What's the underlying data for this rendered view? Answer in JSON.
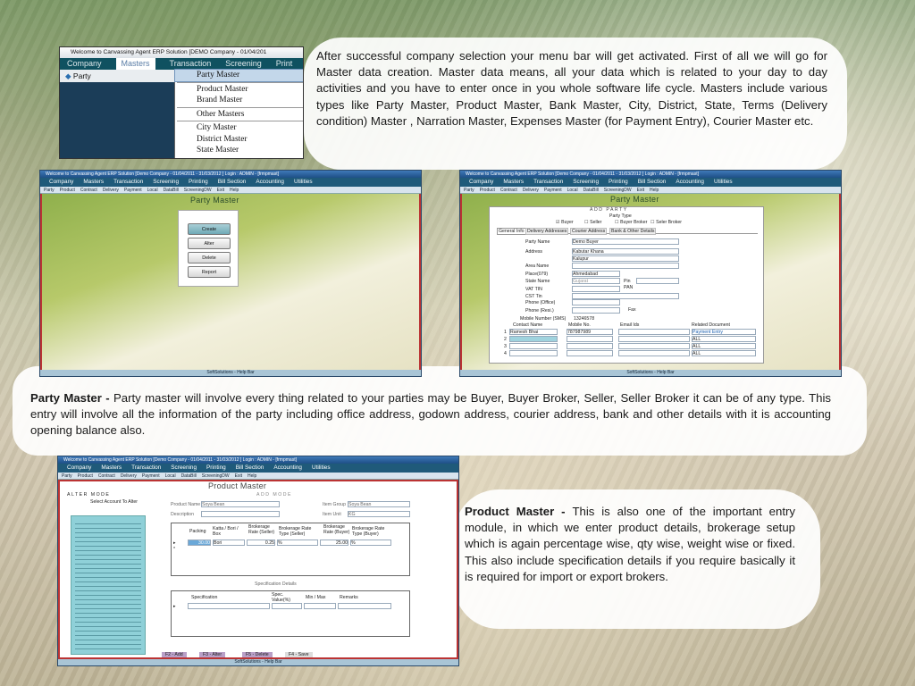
{
  "intro_text": "After successful company selection your menu bar will get activated. First of all we will go for Master data creation. Master data means, all your data which is related to your day to day activities and you have to enter once in you whole software life cycle. Masters include various types like Party Master, Product Master, Bank Master, City, District, State, Terms (Delivery condition)  Master , Narration Master, Expenses Master (for Payment Entry), Courier Master etc.",
  "party_master": {
    "heading": "Party Master",
    "dash": " - ",
    "text": "Party master will involve every thing related to your parties may be Buyer, Buyer Broker, Seller, Seller Broker it can be of any type. This entry will involve all the information of the party including office address, godown address, courier address, bank and other details with it is accounting opening balance also."
  },
  "product_master": {
    "heading": "Product Master",
    "dash": " -  ",
    "text": "This is also one of the important entry module, in which we enter product details, brokerage setup which is again percentage wise, qty wise, weight wise or fixed. This also include specification details if you require basically it is required for import or export brokers."
  },
  "menu_screenshot": {
    "title": "Welcome to Canvassing Agent ERP Solution [DEMO Company - 01/04/201",
    "menubar": [
      "Company",
      "Masters",
      "Transaction",
      "Screening",
      "Print"
    ],
    "toolbar": "Party",
    "toolbar_tail": "t",
    "dropdown": [
      "Party Master",
      "Product Master",
      "Brand Master",
      "Other Masters",
      "City Master",
      "District Master",
      "State Master"
    ]
  },
  "app": {
    "title": "Welcome to Canvassing Agent ERP Solution [Demo Company - 01/04/2011 - 31/03/2012 ] Login : ADMIN - [frmpmast]",
    "menubar": [
      "Company",
      "Masters",
      "Transaction",
      "Screening",
      "Printing",
      "Bill Section",
      "Accounting",
      "Utilities"
    ],
    "toolbar": [
      "Party",
      "Product",
      "Contract",
      "Delivery",
      "Payment",
      "Local",
      "DataBill",
      "ScreeningDW",
      "Exit",
      "Help"
    ],
    "helpbar": "SoftSolutions - Help Bar"
  },
  "party_win1": {
    "form_title": "Party Master",
    "buttons": [
      "Create",
      "Alter",
      "Delete",
      "Report"
    ]
  },
  "party_win2": {
    "form_title": "Party Master",
    "mode": "ADD      PARTY",
    "party_type_label": "Party Type",
    "types": [
      "Buyer",
      "Seller",
      "Buyer Broker",
      "Seler Broker"
    ],
    "tabs": [
      "General Info",
      "Delivery Addresses",
      "Courier Address",
      "Bank & Other Details"
    ],
    "fields": {
      "Party Name": "Demo Buyer",
      "Address": "Kabutar Khana",
      "Address2": "Kalupur",
      "Area Name": "",
      "Place(079)": "Ahmedabad",
      "State Name": "Gujarat",
      "Pin": "Pin",
      "VAT TIN": "",
      "PAN": "PAN",
      "CST Tin": "",
      "Phone (Office)": "",
      "Phone (Resi.)": "",
      "Fax": "Fax",
      "Mobile Number (SMS)": "13246578"
    },
    "contact_headers": [
      "Contact Name",
      "Mobile No.",
      "Email Ids",
      "Related Document"
    ],
    "contacts": [
      {
        "no": "1",
        "name": "Ramesh Bhai",
        "mobile": "787987989",
        "doc": "Payment Entry"
      },
      {
        "no": "2",
        "name": "",
        "mobile": "",
        "doc": "ALL"
      },
      {
        "no": "3",
        "name": "",
        "mobile": "",
        "doc": "ALL"
      },
      {
        "no": "4",
        "name": "",
        "mobile": "",
        "doc": "ALL"
      }
    ]
  },
  "product_win": {
    "form_title": "Product Master",
    "alter_mode": "ALTER   MODE",
    "select_label": "Select Account To Alter",
    "add_mode": "ADD   MODE",
    "product_name_label": "Product Name",
    "product_name": "Soya Bean",
    "item_group_label": "Item Group",
    "item_group": "Soya Bean",
    "description_label": "Description",
    "item_unit_label": "Item Unit",
    "item_unit": "KG",
    "grid_headers": [
      "Packing",
      "Katta / Bori / Box",
      "Brokerage Rate (Seller)",
      "Brokerage Rate Type (Seller)",
      "Brokerage Rate (Buyer)",
      "Brokerage Rate Type (Buyer)"
    ],
    "grid_row": [
      "30.00",
      "Bori",
      "0.25",
      "%",
      "25.00",
      "%"
    ],
    "spec_title": "Specification Details",
    "spec_headers": [
      "Specification",
      "Spec. Value(%)",
      "Min / Max",
      "Remarks"
    ],
    "fkeys": [
      "F2 - Add",
      "F3 - Alter",
      "F5 - Delete",
      "F4 - Save"
    ]
  }
}
